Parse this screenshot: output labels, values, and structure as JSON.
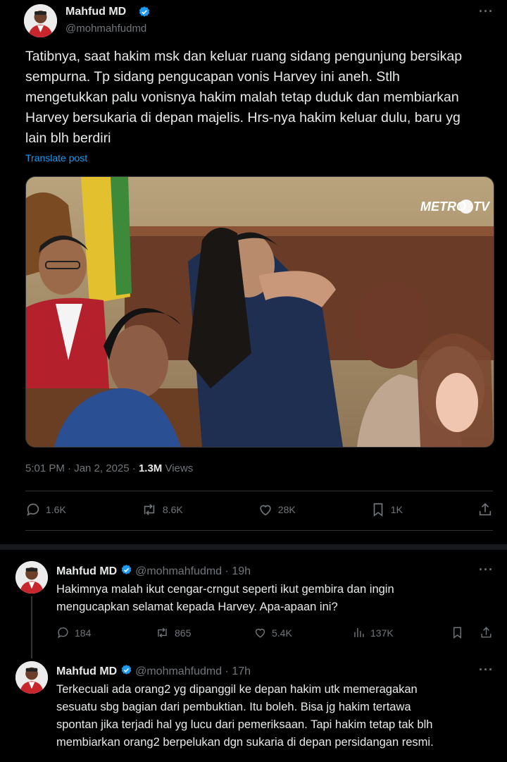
{
  "main_post": {
    "author_name": "Mahfud MD",
    "handle": "@mohmahfudmd",
    "more": "···",
    "text_lines": [
      "Tatibnya, saat hakim msk dan keluar ruang sidang pengunjung bersikap",
      "sempurna. Tp sidang pengucapan vonis Harvey ini aneh. Stlh",
      "mengetukkan palu vonisnya hakim malah tetap duduk dan membiarkan",
      "Harvey bersukaria di depan majelis. Hrs-nya hakim keluar dulu, baru yg",
      "lain blh berdiri"
    ],
    "translate": "Translate post",
    "media": {
      "watermark": "METRO TV"
    },
    "timestamp": "5:01 PM · Jan 2, 2025 ·",
    "views_count": "1.3M",
    "views_label": "Views",
    "actions": {
      "replies": "1.6K",
      "reposts": "8.6K",
      "likes": "28K",
      "bookmarks": "1K"
    }
  },
  "replies": [
    {
      "author_name": "Mahfud MD",
      "handle": "@mohmahfudmd",
      "time": "· 19h",
      "more": "···",
      "text_lines": [
        "Hakimnya malah ikut cengar-crngut seperti ikut gembira dan ingin",
        "mengucapkan selamat kepada Harvey. Apa-apaan ini?"
      ],
      "actions": {
        "replies": "184",
        "reposts": "865",
        "likes": "5.4K",
        "views": "137K"
      }
    },
    {
      "author_name": "Mahfud MD",
      "handle": "@mohmahfudmd",
      "time": "· 17h",
      "more": "···",
      "text_lines": [
        "Terkecuali ada orang2 yg dipanggil ke depan hakim utk memeragakan",
        "sesuatu sbg bagian dari pembuktian. Itu boleh. Bisa jg hakim tertawa",
        "spontan jika terjadi hal yg lucu dari pemeriksaan. Tapi hakim  tetap tak blh",
        "membiarkan orang2 berpelukan dgn sukaria di depan persidangan resmi."
      ]
    }
  ],
  "colors": {
    "background": "#000000",
    "text": "#e7e9ea",
    "muted": "#71767b",
    "link": "#1d9bf0",
    "verified": "#1d9bf0",
    "border": "#2f3336"
  },
  "icons": [
    "avatar",
    "verified-badge-icon",
    "more-icon",
    "reply-icon",
    "repost-icon",
    "like-icon",
    "views-icon",
    "bookmark-icon",
    "share-icon"
  ]
}
